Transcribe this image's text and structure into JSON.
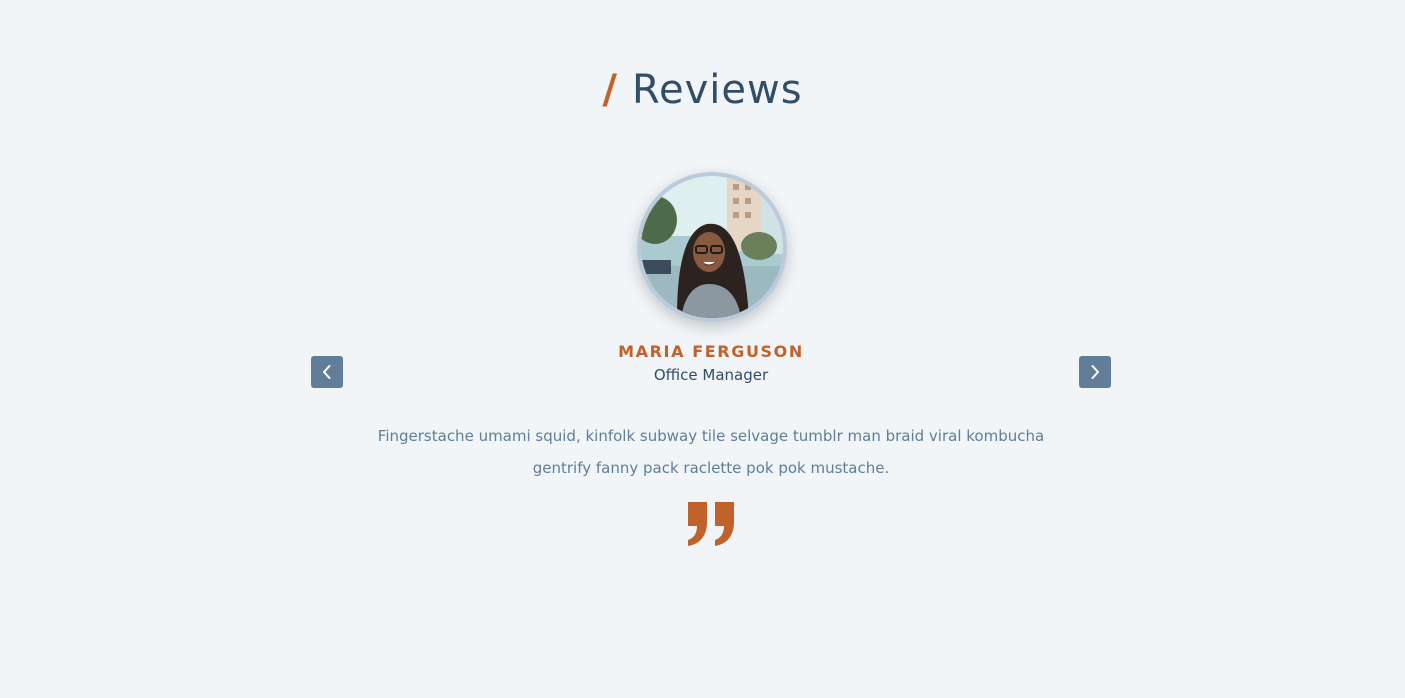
{
  "section": {
    "title_prefix": "/",
    "title": "Reviews"
  },
  "review": {
    "name": "Maria Ferguson",
    "job": "Office Manager",
    "text": "Fingerstache umami squid, kinfolk subway tile selvage tumblr man braid viral kombucha gentrify fanny pack raclette pok pok mustache."
  },
  "icons": {
    "prev": "chevron-left-icon",
    "next": "chevron-right-icon",
    "quote": "quote-right-icon"
  },
  "colors": {
    "background": "#f1f5f8",
    "accent": "#c0622a",
    "heading": "#324d67",
    "button": "#617d98",
    "text": "#617d98"
  }
}
